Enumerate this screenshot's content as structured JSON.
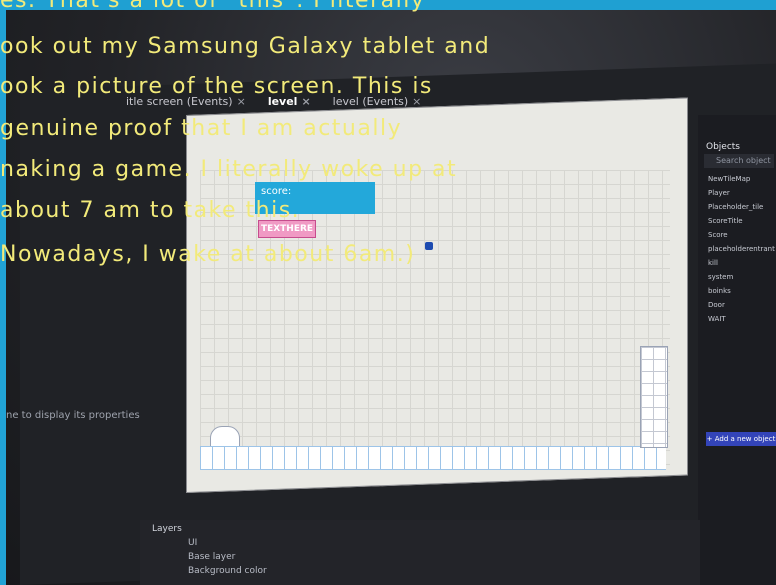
{
  "editor": {
    "tabs": [
      {
        "label": "itle screen (Events)",
        "close": "×"
      },
      {
        "label": "level",
        "close": "×"
      },
      {
        "label": "level (Events)",
        "close": "×"
      }
    ],
    "left_panel_hint": "ne to display its properties",
    "score_label": "score:",
    "text_here_label": "TEXTHERE",
    "right_panel": {
      "title": "Objects",
      "search_placeholder": "Search object",
      "items": [
        "NewTileMap",
        "Player",
        "Placeholder_tile",
        "ScoreTitle",
        "Score",
        "placeholderentrant",
        "kill",
        "system",
        "boinks",
        "Door",
        "WAIT"
      ],
      "add_button": "+ Add a new object"
    },
    "layers": {
      "title": "Layers",
      "rows": [
        "UI",
        "Base layer",
        "Background color"
      ]
    }
  },
  "overlay_text": {
    "lines": [
      "es. That's a lot of \"this\". I literally",
      "ook out my Samsung Galaxy tablet and",
      "ook a picture of the screen. This is",
      "genuine proof that I am actually",
      "naking a game. I literally woke up at",
      "about 7 am to take this.",
      "Nowadays, I wake at about 6am.)"
    ],
    "color": "#f2ea7a"
  }
}
